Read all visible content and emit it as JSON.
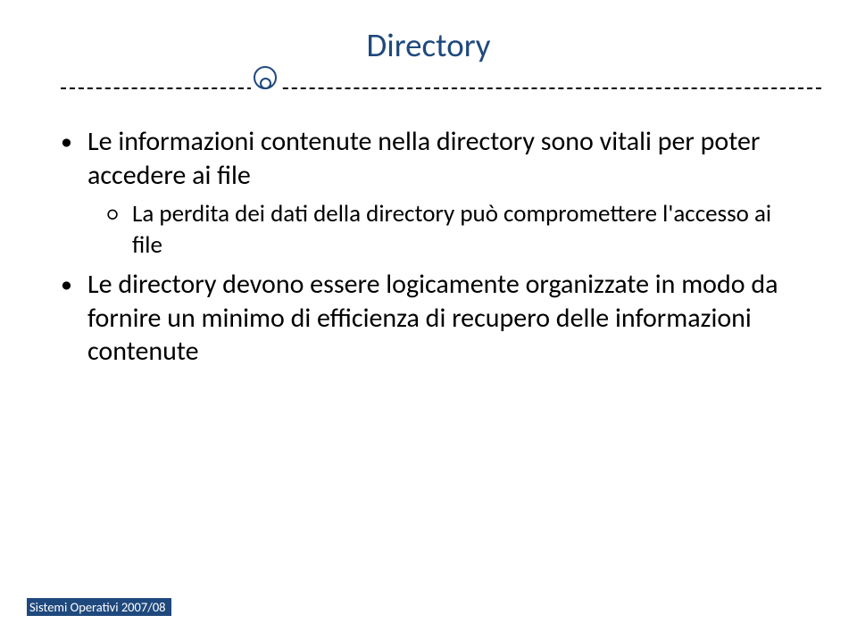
{
  "title": "Directory",
  "bullets": [
    {
      "level": 1,
      "text": "Le informazioni contenute nella directory sono vitali per poter accedere ai file"
    },
    {
      "level": 2,
      "text": "La perdita dei dati della directory può compromettere l'accesso ai file"
    },
    {
      "level": 1,
      "text": "Le directory devono essere logicamente organizzate in modo da fornire un minimo di efficienza di recupero delle informazioni contenute"
    }
  ],
  "footer": "Sistemi Operativi 2007/08"
}
